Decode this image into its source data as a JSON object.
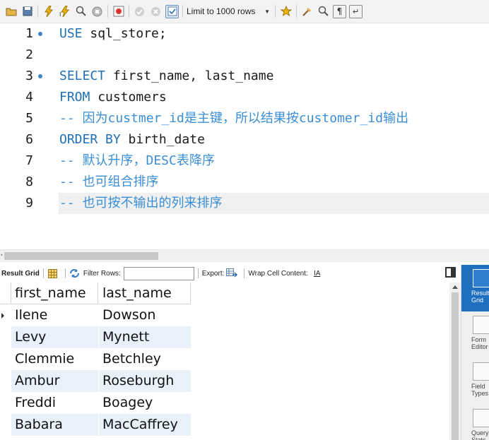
{
  "toolbar": {
    "limit_select": "Limit to 1000 rows",
    "icons": [
      "open-file-icon",
      "save-icon",
      "execute-icon",
      "execute-current-icon",
      "explain-icon",
      "stop-icon",
      "toggle-errors-icon",
      "commit-icon",
      "rollback-icon",
      "autocommit-icon",
      "bookmark-icon",
      "beautify-icon",
      "find-icon",
      "invisible-chars-icon",
      "wrap-icon"
    ]
  },
  "editor": {
    "lines": [
      {
        "num": "1",
        "parts": [
          {
            "t": "USE",
            "c": "kw"
          },
          {
            "t": " sql_store;",
            "c": ""
          }
        ]
      },
      {
        "num": "2",
        "parts": []
      },
      {
        "num": "3",
        "parts": [
          {
            "t": "SELECT",
            "c": "kw"
          },
          {
            "t": " first_name, last_name",
            "c": ""
          }
        ]
      },
      {
        "num": "4",
        "parts": [
          {
            "t": "FROM",
            "c": "kw"
          },
          {
            "t": " customers",
            "c": ""
          }
        ]
      },
      {
        "num": "5",
        "parts": [
          {
            "t": "-- 因为custmer_id是主键，所以结果按customer_id输出",
            "c": "cm"
          }
        ]
      },
      {
        "num": "6",
        "parts": [
          {
            "t": "ORDER BY",
            "c": "kw"
          },
          {
            "t": " birth_date",
            "c": ""
          }
        ]
      },
      {
        "num": "7",
        "parts": [
          {
            "t": "-- 默认升序，DESC表降序",
            "c": "cm"
          }
        ]
      },
      {
        "num": "8",
        "parts": [
          {
            "t": "-- 也可组合排序",
            "c": "cm"
          }
        ]
      },
      {
        "num": "9",
        "parts": [
          {
            "t": "-- 也可按不输出的列来排序",
            "c": "cm"
          }
        ]
      }
    ]
  },
  "result_toolbar": {
    "result_grid_label": "Result Grid",
    "filter_rows_label": "Filter Rows:",
    "filter_value": "",
    "export_label": "Export:",
    "wrap_label": "Wrap Cell Content:"
  },
  "grid": {
    "columns": [
      "first_name",
      "last_name"
    ],
    "rows": [
      [
        "Ilene",
        "Dowson"
      ],
      [
        "Levy",
        "Mynett"
      ],
      [
        "Clemmie",
        "Betchley"
      ],
      [
        "Ambur",
        "Roseburgh"
      ],
      [
        "Freddi",
        "Boagey"
      ],
      [
        "Babara",
        "MacCaffrey"
      ]
    ]
  },
  "side_panel": [
    {
      "label": "Result\nGrid",
      "active": true
    },
    {
      "label": "Form\nEditor",
      "active": false
    },
    {
      "label": "Field\nTypes",
      "active": false
    },
    {
      "label": "Query\nStats",
      "active": false
    }
  ],
  "colors": {
    "keyword": "#1f6fb5",
    "comment": "#3a8ed6",
    "alt_row": "#e8f0fa",
    "side_active": "#1e6fc0"
  }
}
